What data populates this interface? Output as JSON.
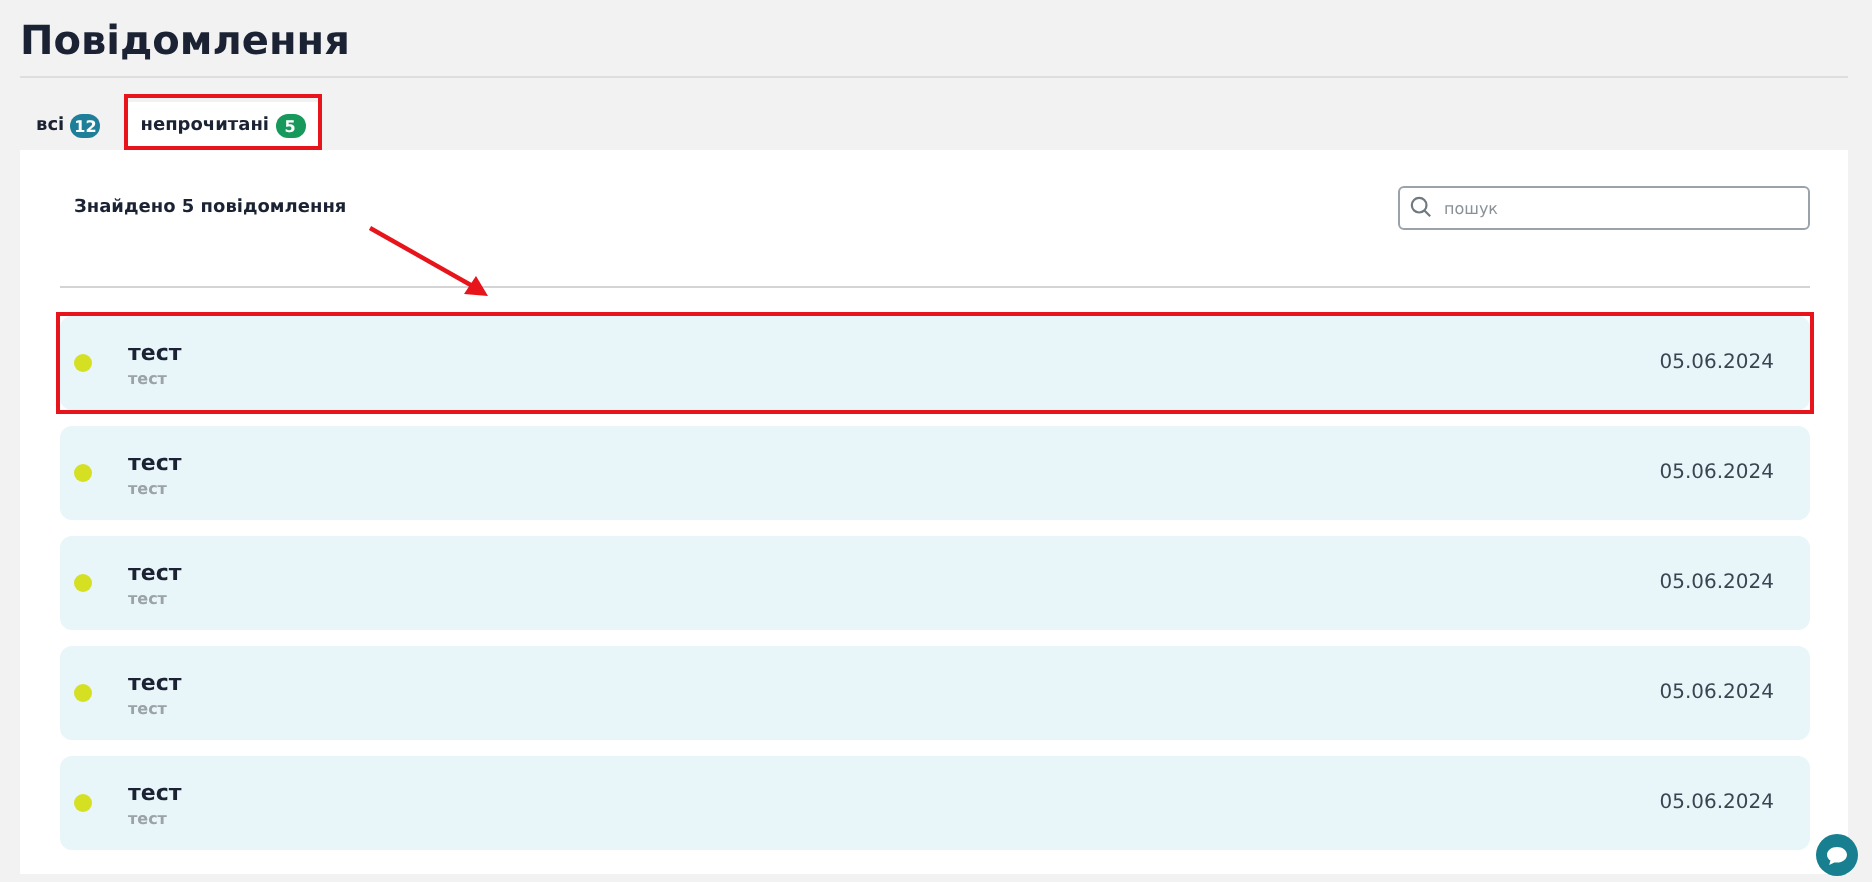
{
  "page": {
    "title": "Повідомлення"
  },
  "tabs": [
    {
      "label": "всі",
      "count": "12",
      "selected": false,
      "highlighted": false
    },
    {
      "label": "непрочитані",
      "count": "5",
      "selected": true,
      "highlighted": true
    }
  ],
  "results": {
    "summary": "Знайдено 5 повідомлення",
    "pointer_arrow": true
  },
  "search": {
    "placeholder": "пошук"
  },
  "messages": [
    {
      "title": "тест",
      "text": "тест",
      "date": "05.06.2024",
      "unread": true,
      "highlighted": true
    },
    {
      "title": "тест",
      "text": "тест",
      "date": "05.06.2024",
      "unread": true,
      "highlighted": false
    },
    {
      "title": "тест",
      "text": "тест",
      "date": "05.06.2024",
      "unread": true,
      "highlighted": false
    },
    {
      "title": "тест",
      "text": "тест",
      "date": "05.06.2024",
      "unread": true,
      "highlighted": false
    },
    {
      "title": "тест",
      "text": "тест",
      "date": "05.06.2024",
      "unread": true,
      "highlighted": false
    }
  ]
}
